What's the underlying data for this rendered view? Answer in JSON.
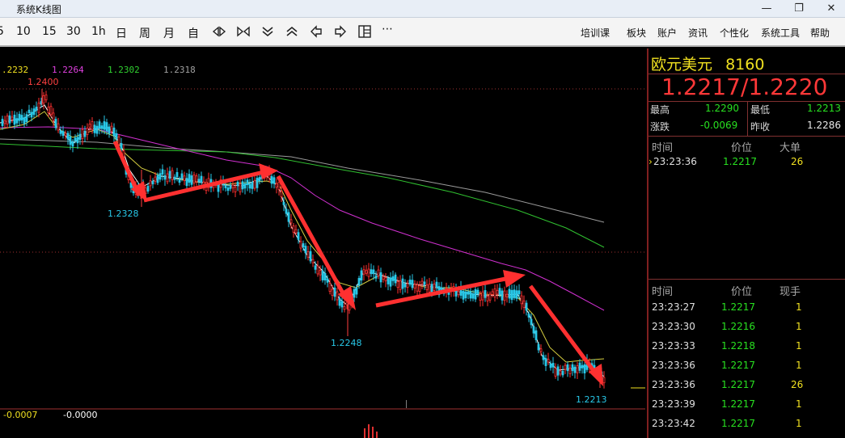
{
  "window": {
    "title": "系统K线图"
  },
  "toolbar": {
    "periods": [
      "5",
      "10",
      "15",
      "30",
      "1h",
      "日",
      "周",
      "月",
      "自"
    ],
    "menus": [
      "培训课",
      "板块",
      "账户",
      "资讯",
      "个性化",
      "系统工具",
      "帮助"
    ]
  },
  "legend": [
    {
      "text": ".2232",
      "color": "#f0e020"
    },
    {
      "text": "1.2264",
      "color": "#e040e0"
    },
    {
      "text": "1.2302",
      "color": "#30d030"
    },
    {
      "text": "1.2318",
      "color": "#a0a0a0"
    }
  ],
  "chart_data": {
    "type": "candlestick",
    "annotations": [
      "1.2400",
      "1.2328",
      "1.2248",
      "1.2213"
    ],
    "indicator_values": [
      "-0.0007",
      "-0.0000"
    ]
  },
  "quote": {
    "name": "欧元美元",
    "code": "8160",
    "bid_ask": "1.2217/1.2220",
    "high_label": "最高",
    "high": "1.2290",
    "low_label": "最低",
    "low": "1.2213",
    "change_label": "涨跌",
    "change": "-0.0069",
    "prev_close_label": "昨收",
    "prev_close": "1.2286"
  },
  "big_orders": {
    "headers": [
      "时间",
      "价位",
      "大单"
    ],
    "rows": [
      {
        "time": "23:23:36",
        "price": "1.2217",
        "vol": "26"
      }
    ]
  },
  "ticks": {
    "headers": [
      "时间",
      "价位",
      "现手"
    ],
    "rows": [
      {
        "time": "23:23:27",
        "price": "1.2217",
        "vol": "1"
      },
      {
        "time": "23:23:30",
        "price": "1.2216",
        "vol": "1"
      },
      {
        "time": "23:23:33",
        "price": "1.2218",
        "vol": "1"
      },
      {
        "time": "23:23:36",
        "price": "1.2217",
        "vol": "1"
      },
      {
        "time": "23:23:36",
        "price": "1.2217",
        "vol": "26"
      },
      {
        "time": "23:23:39",
        "price": "1.2217",
        "vol": "1"
      },
      {
        "time": "23:23:42",
        "price": "1.2217",
        "vol": "1"
      }
    ]
  }
}
